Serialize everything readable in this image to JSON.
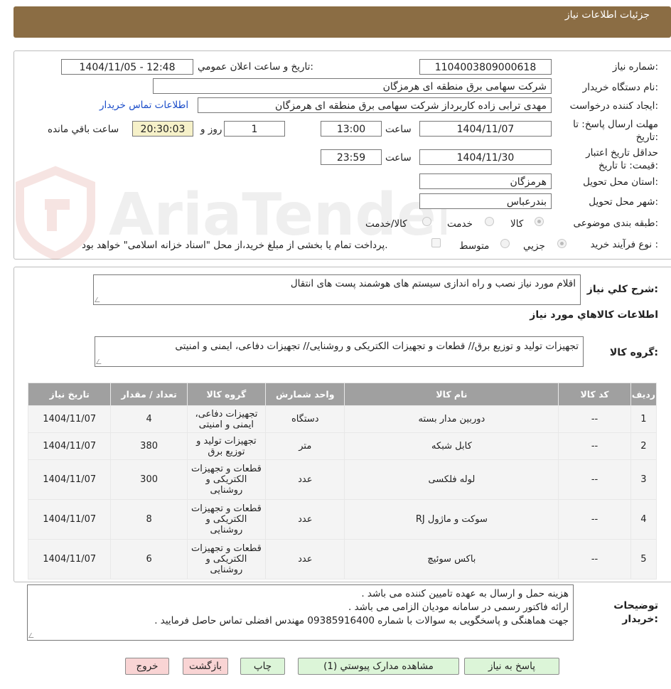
{
  "header": {
    "title": "جزئیات اطلاعات نیاز"
  },
  "form": {
    "need_number_label": "شماره نیاز:",
    "need_number": "1104003809000618",
    "announce_label": "تاريخ و ساعت اعلان عمومي:",
    "announce_value": "1404/11/05 - 12:48",
    "buyer_org_label": "نام دستگاه خريدار:",
    "buyer_org": "شرکت سهامی برق منطقه ای هرمزگان",
    "creator_label": "ايجاد کننده درخواست:",
    "creator": "مهدی ترابی زاده کاربرداز شرکت سهامی برق منطقه ای هرمزگان",
    "contact_link": "اطلاعات تماس خريدار",
    "reply_deadline_label": "مهلت ارسال پاسخ: تا تاريخ:",
    "reply_date": "1404/11/07",
    "time_label": "ساعت",
    "reply_time": "13:00",
    "days": "1",
    "day_and_label": "روز و",
    "remaining_time": "20:30:03",
    "remaining_label": "ساعت باقي مانده",
    "validity_label": "حداقل تاريخ اعتبار قيمت: تا تاريخ:",
    "validity_date": "1404/11/30",
    "validity_time": "23:59",
    "province_label": "استان محل تحويل:",
    "province": "هرمزگان",
    "city_label": "شهر محل تحويل:",
    "city": "بندرعباس",
    "category_label": "طبقه بندی موضوعی:",
    "category_options": [
      "کالا",
      "خدمت",
      "کالا/خدمت"
    ],
    "process_label": "نوع فرآيند خريد :",
    "process_options": [
      "جزیي",
      "متوسط"
    ],
    "payment_note": "پرداخت تمام يا بخشی از مبلغ خريد،از محل \"اسناد خزانه اسلامی\" خواهد بود."
  },
  "details": {
    "summary_label": "شرح کلي نياز:",
    "summary": "اقلام مورد نیاز نصب و راه اندازی سیستم های هوشمند پست های انتقال",
    "items_heading": "اطلاعات کالاهاي مورد نياز",
    "group_label": "گروه کالا:",
    "group_value": "تجهیزات تولید و توزیع برق// قطعات و تجهیزات الکتریکی و روشنایی// تجهیزات دفاعی، ایمنی و امنیتی"
  },
  "table": {
    "headers": [
      "رديف",
      "کد کالا",
      "نام کالا",
      "واحد شمارش",
      "گروه کالا",
      "تعداد / مقدار",
      "تاريخ نياز"
    ],
    "rows": [
      [
        "1",
        "--",
        "دوربین مدار بسته",
        "دستگاه",
        "تجهیزات دفاعی، ایمنی و امنیتی",
        "4",
        "1404/11/07"
      ],
      [
        "2",
        "--",
        "کابل شبکه",
        "متر",
        "تجهیزات تولید و توزیع برق",
        "380",
        "1404/11/07"
      ],
      [
        "3",
        "--",
        "لوله فلکسی",
        "عدد",
        "قطعات و تجهیزات الکتریکی و روشنایی",
        "300",
        "1404/11/07"
      ],
      [
        "4",
        "--",
        "سوکت و ماژول RJ",
        "عدد",
        "قطعات و تجهیزات الکتریکی و روشنایی",
        "8",
        "1404/11/07"
      ],
      [
        "5",
        "--",
        "باکس سوئیچ",
        "عدد",
        "قطعات و تجهیزات الکتریکی و روشنایی",
        "6",
        "1404/11/07"
      ]
    ]
  },
  "notes": {
    "label": "توضیحات خریدار:",
    "lines": [
      "هزینه حمل و ارسال به عهده تامیین کننده می باشد .",
      "ارائه فاکتور رسمی در سامانه مودیان الزامی می باشد .",
      "جهت هماهنگی و پاسخگویی به سوالات با شماره 09385916400 مهندس افضلی تماس حاصل فرمایید ."
    ]
  },
  "buttons": {
    "reply": "پاسخ به نیاز",
    "docs": "مشاهده مدارک پیوستي (1)",
    "print": "چاپ",
    "back": "بازگشت",
    "exit": "خروج"
  },
  "watermark": {
    "text": "AriaTender.neT"
  }
}
